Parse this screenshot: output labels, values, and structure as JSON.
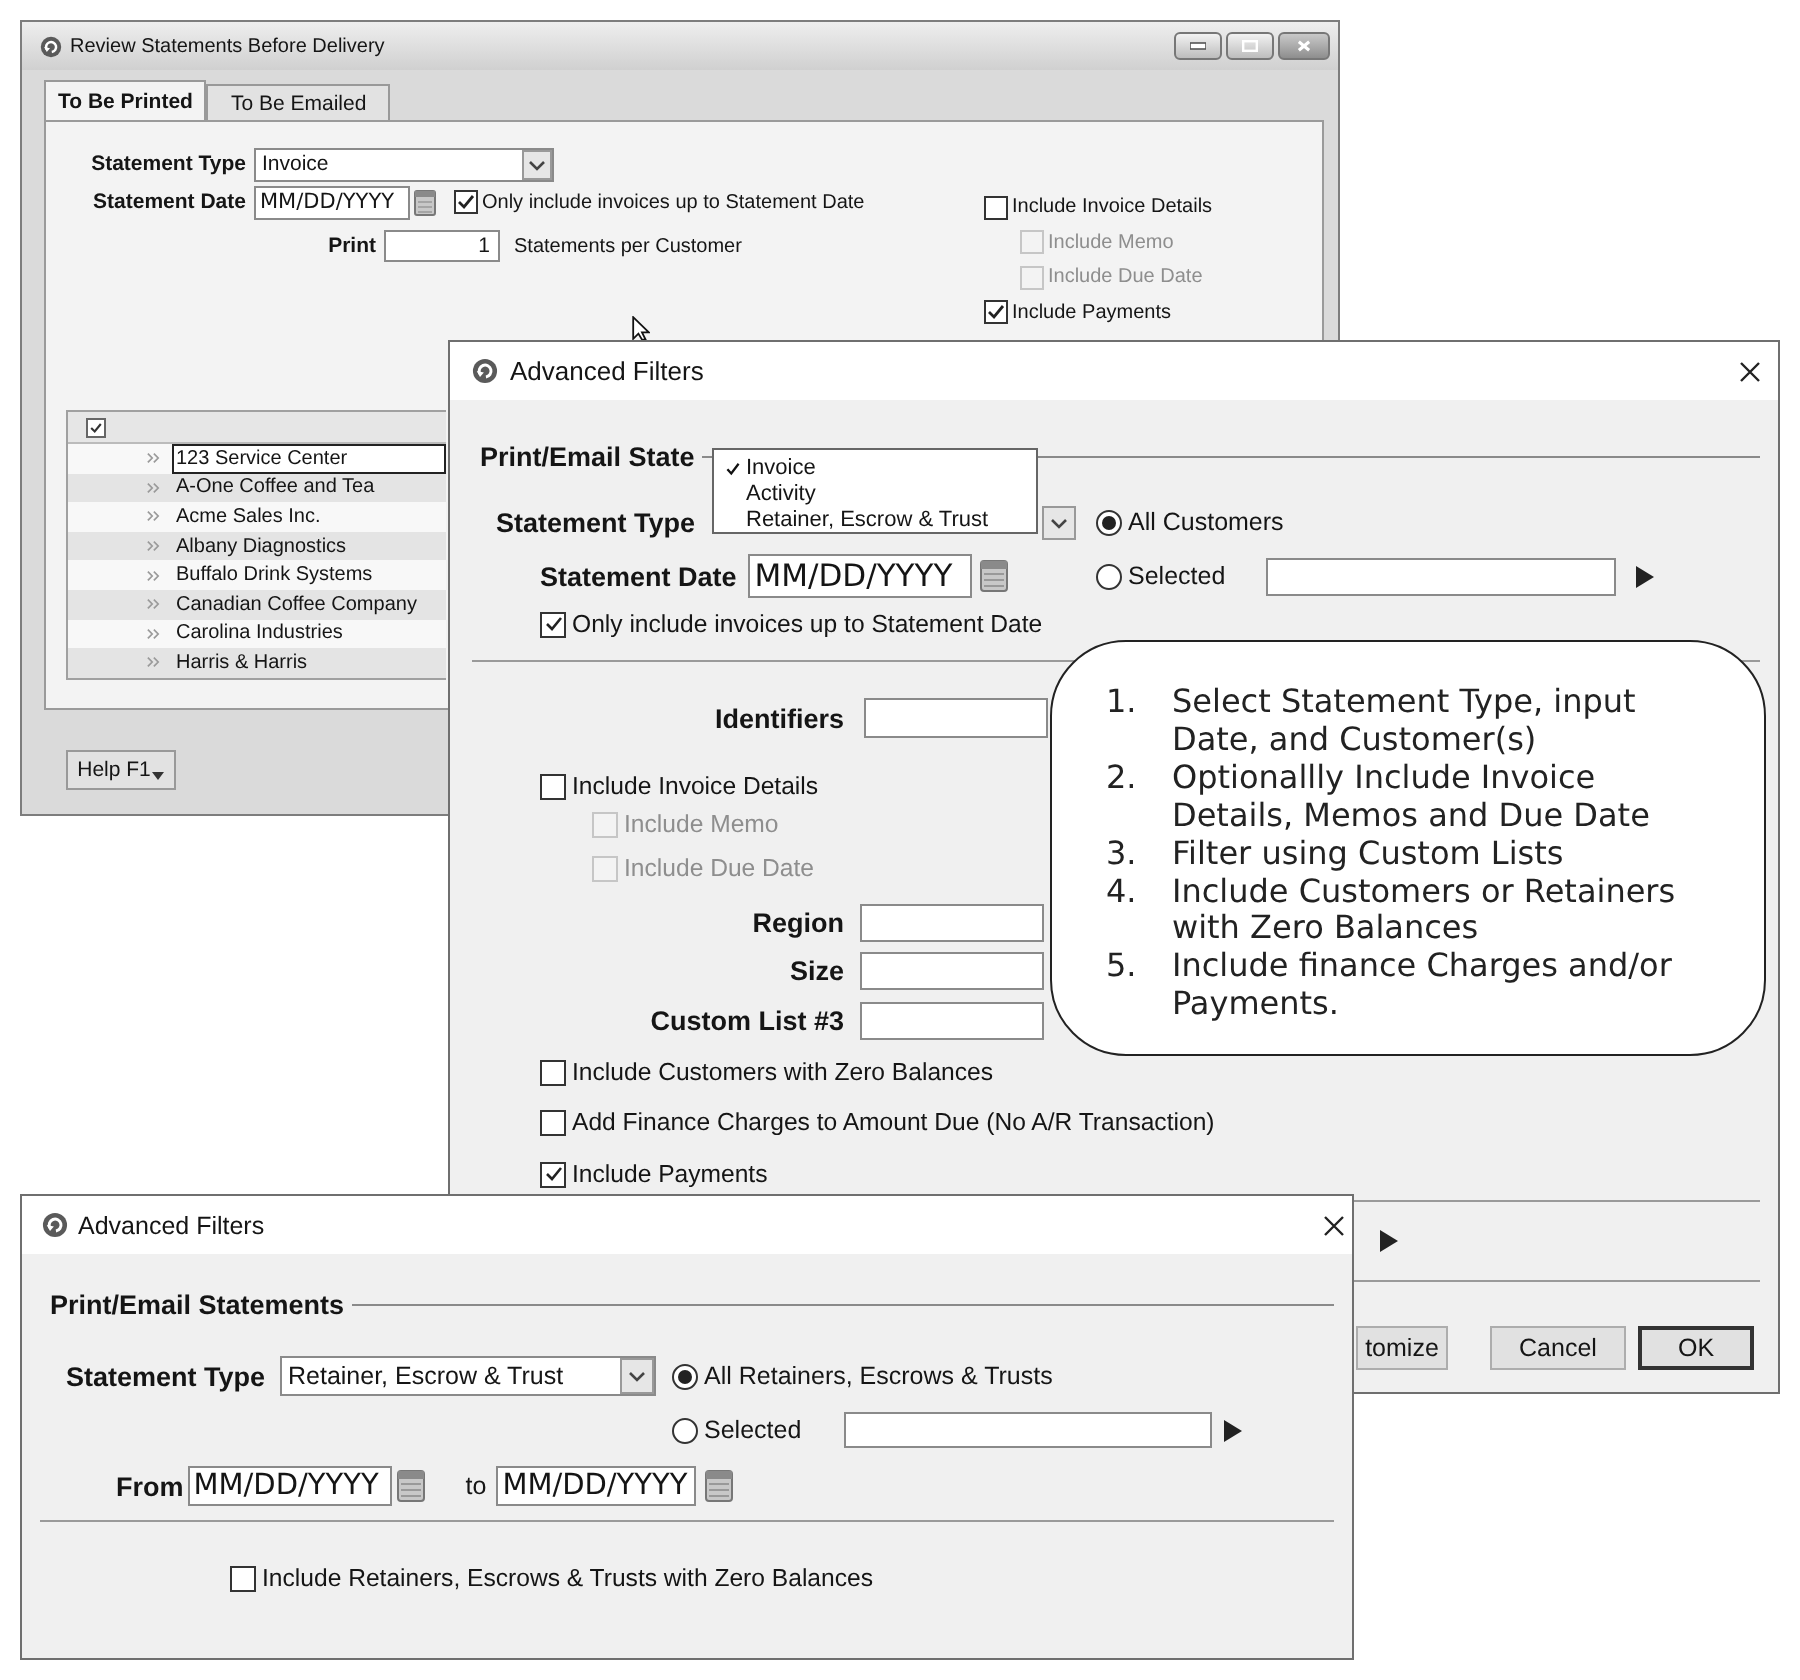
{
  "review_window": {
    "title": "Review Statements Before Delivery",
    "tabs": [
      {
        "label": "To Be Printed",
        "selected": true
      },
      {
        "label": "To Be Emailed",
        "selected": false
      }
    ],
    "statement_type": {
      "label": "Statement Type",
      "value": "Invoice"
    },
    "statement_date": {
      "label": "Statement Date",
      "value": "MM/DD/YYYY"
    },
    "only_up_to_date": {
      "label": "Only include invoices up to Statement Date",
      "checked": true
    },
    "print": {
      "label": "Print",
      "value": "1",
      "suffix": "Statements per Customer"
    },
    "options": [
      {
        "label": "Include Invoice Details",
        "checked": false,
        "disabled": false,
        "children": [
          {
            "label": "Include Memo",
            "checked": false,
            "disabled": true
          },
          {
            "label": "Include Due Date",
            "checked": false,
            "disabled": true
          }
        ]
      },
      {
        "label": "Include Payments",
        "checked": true,
        "disabled": false
      }
    ],
    "customer_list": {
      "select_all_checked": true,
      "rows": [
        {
          "name": "123 Service Center",
          "selected": true
        },
        {
          "name": "A-One Coffee and Tea",
          "selected": false
        },
        {
          "name": "Acme Sales Inc.",
          "selected": false
        },
        {
          "name": "Albany Diagnostics",
          "selected": false
        },
        {
          "name": "Buffalo Drink Systems",
          "selected": false
        },
        {
          "name": "Canadian Coffee Company",
          "selected": false
        },
        {
          "name": "Carolina Industries",
          "selected": false
        },
        {
          "name": "Harris & Harris",
          "selected": false
        }
      ]
    },
    "help_button": {
      "label": "Help F1"
    }
  },
  "filters_window": {
    "title": "Advanced Filters",
    "section_title": "Print/Email State",
    "type_menu": [
      {
        "label": "Invoice",
        "selected": true
      },
      {
        "label": "Activity",
        "selected": false
      },
      {
        "label": "Retainer, Escrow & Trust",
        "selected": false
      }
    ],
    "statement_type_label": "Statement Type",
    "scope": [
      {
        "label": "All Customers",
        "selected": true
      },
      {
        "label": "Selected",
        "selected": false
      }
    ],
    "statement_date": {
      "label": "Statement Date",
      "value": "MM/DD/YYYY"
    },
    "only_up_to_date": {
      "label": "Only include invoices up to Statement Date",
      "checked": true
    },
    "identifiers_label": "Identifiers",
    "invoice_details": {
      "label": "Include Invoice Details",
      "checked": false,
      "disabled": false,
      "children": [
        {
          "label": "Include Memo",
          "checked": false,
          "disabled": true
        },
        {
          "label": "Include Due Date",
          "checked": false,
          "disabled": true
        }
      ]
    },
    "custom_lists": [
      {
        "label": "Region"
      },
      {
        "label": "Size"
      },
      {
        "label": "Custom List #3"
      }
    ],
    "options": [
      {
        "label": "Include Customers with Zero Balances",
        "checked": false
      },
      {
        "label": "Add Finance Charges to Amount Due (No A/R Transaction)",
        "checked": false
      },
      {
        "label": "Include Payments",
        "checked": true
      }
    ],
    "buttons": [
      {
        "label": "tomize",
        "default": false
      },
      {
        "label": "Cancel",
        "default": false
      },
      {
        "label": "OK",
        "default": true
      }
    ],
    "callout": [
      {
        "number": "1.",
        "text": "Select Statement Type, input Date, and Customer(s)"
      },
      {
        "number": "2.",
        "text": "Optionallly Include Invoice Details, Memos and Due Date"
      },
      {
        "number": "3.",
        "text": "Filter using Custom Lists"
      },
      {
        "number": "4.",
        "text": "Include Customers or Retainers with Zero Balances"
      },
      {
        "number": "5.",
        "text": "Include finance Charges and/or Payments."
      }
    ]
  },
  "retainer_window": {
    "title": "Advanced Filters",
    "section_title": "Print/Email Statements",
    "statement_type": {
      "label": "Statement Type",
      "value": "Retainer, Escrow & Trust"
    },
    "scope": [
      {
        "label": "All Retainers, Escrows & Trusts",
        "selected": true
      },
      {
        "label": "Selected",
        "selected": false
      }
    ],
    "from": {
      "label": "From",
      "value": "MM/DD/YYYY"
    },
    "to": {
      "label": "to",
      "value": "MM/DD/YYYY"
    },
    "zero_balances": {
      "label": "Include Retainers, Escrows & Trusts with Zero Balances",
      "checked": false
    }
  }
}
